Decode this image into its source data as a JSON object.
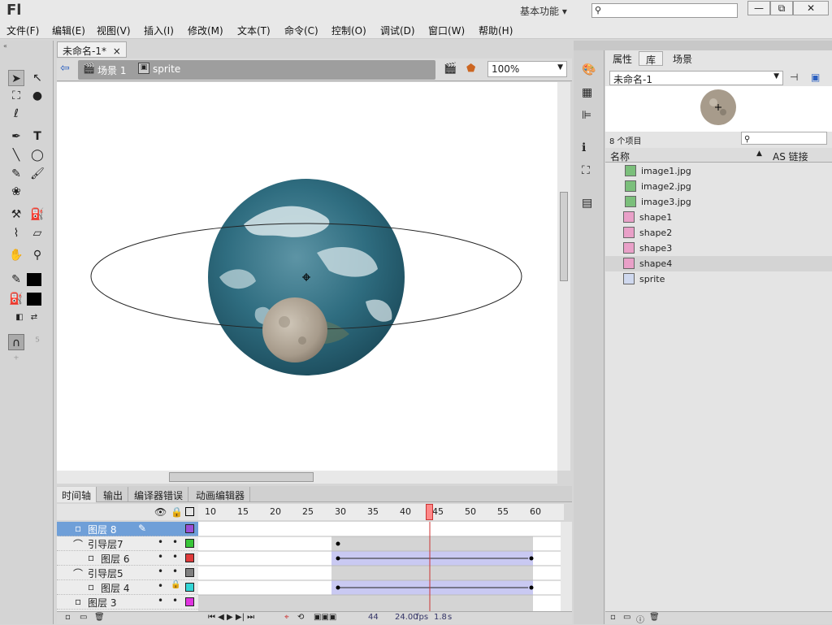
{
  "app": {
    "logo": "Fl",
    "workspace": "基本功能",
    "window_buttons": [
      "—",
      "⧉",
      "✕"
    ]
  },
  "menu": [
    "文件(F)",
    "编辑(E)",
    "视图(V)",
    "插入(I)",
    "修改(M)",
    "文本(T)",
    "命令(C)",
    "控制(O)",
    "调试(D)",
    "窗口(W)",
    "帮助(H)"
  ],
  "document": {
    "tab": "未命名-1*",
    "close": "×",
    "scene": "场景 1",
    "symbol": "sprite",
    "zoom": "100%"
  },
  "timeline": {
    "tabs": [
      "时间轴",
      "输出",
      "编译器错误",
      "动画编辑器"
    ],
    "ruler": [
      "10",
      "15",
      "20",
      "25",
      "30",
      "35",
      "40",
      "45",
      "50",
      "55",
      "60"
    ],
    "layers": [
      {
        "name": "图层 8",
        "selected": true,
        "color": "#9b4fd6"
      },
      {
        "name": "引导层7",
        "color": "#39c639"
      },
      {
        "name": "图层 6",
        "color": "#e03b3b"
      },
      {
        "name": "引导层5",
        "color": "#808080"
      },
      {
        "name": "图层 4",
        "color": "#34d6d6"
      },
      {
        "name": "图层 3",
        "color": "#e034e0"
      }
    ],
    "status": {
      "frame": "44",
      "fps": "24.00",
      "fps_unit": "fps",
      "time": "1.8",
      "time_unit": "s"
    }
  },
  "library": {
    "tabs": [
      "属性",
      "库",
      "场景"
    ],
    "doc": "未命名-1",
    "count": "8 个项目",
    "col_name": "名称",
    "col_link": "AS 链接",
    "items": [
      {
        "name": "image1.jpg",
        "type": "image"
      },
      {
        "name": "image2.jpg",
        "type": "image"
      },
      {
        "name": "image3.jpg",
        "type": "image"
      },
      {
        "name": "shape1",
        "type": "shape"
      },
      {
        "name": "shape2",
        "type": "shape"
      },
      {
        "name": "shape3",
        "type": "shape"
      },
      {
        "name": "shape4",
        "type": "shape",
        "selected": true
      },
      {
        "name": "sprite",
        "type": "symbol"
      }
    ]
  }
}
